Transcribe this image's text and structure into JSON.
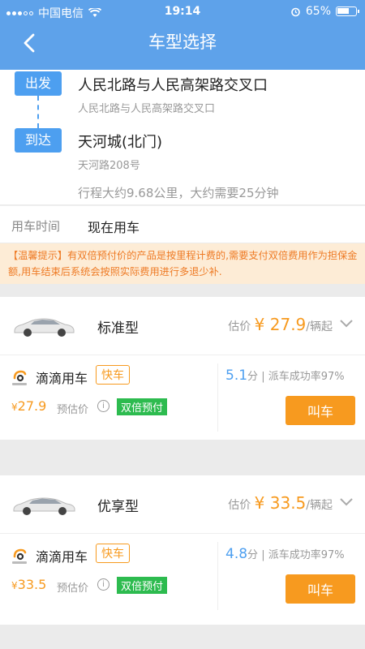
{
  "status_bar": {
    "carrier": "中国电信",
    "time": "19:14",
    "battery": "65%",
    "battery_level": 0.65
  },
  "header": {
    "title": "车型选择"
  },
  "route": {
    "from_tag": "出发",
    "from_name": "人民北路与人民高架路交叉口",
    "from_address": "人民北路与人民高架路交叉口",
    "to_tag": "到达",
    "to_name": "天河城(北门)",
    "to_address": "天河路208号",
    "trip_info": "行程大约9.68公里，大约需要25分钟"
  },
  "time_row": {
    "label": "用车时间",
    "value": "现在用车"
  },
  "tip": {
    "text": "【温馨提示】有双倍预付价的产品是按里程计费的,需要支付双倍费用作为担保金额,用车结束后系统会按照实际费用进行多退少补."
  },
  "cars": [
    {
      "name": "标准型",
      "est_label": "估价",
      "price": "¥ 27.9",
      "unit": "/辆起",
      "offer": {
        "brand": "滴滴用车",
        "badge": "快车",
        "price_yen": "¥",
        "price": "27.9",
        "price_label": "预估价",
        "badge_double": "双倍预付",
        "eta": "5.1",
        "eta_unit": "分",
        "success_rate": "| 派车成功率97%",
        "button": "叫车",
        "logo_text": "滴滴出行"
      }
    },
    {
      "name": "优享型",
      "est_label": "估价",
      "price": "¥ 33.5",
      "unit": "/辆起",
      "offer": {
        "brand": "滴滴用车",
        "badge": "快车",
        "price_yen": "¥",
        "price": "33.5",
        "price_label": "预估价",
        "badge_double": "双倍预付",
        "eta": "4.8",
        "eta_unit": "分",
        "success_rate": "| 派车成功率97%",
        "button": "叫车",
        "logo_text": "滴滴出行"
      }
    }
  ],
  "colors": {
    "header": "#5ea2ea",
    "accent": "#f79a1f",
    "blue": "#4d9ff0",
    "green": "#2dbb4f",
    "tip_bg": "#fdecd6"
  }
}
